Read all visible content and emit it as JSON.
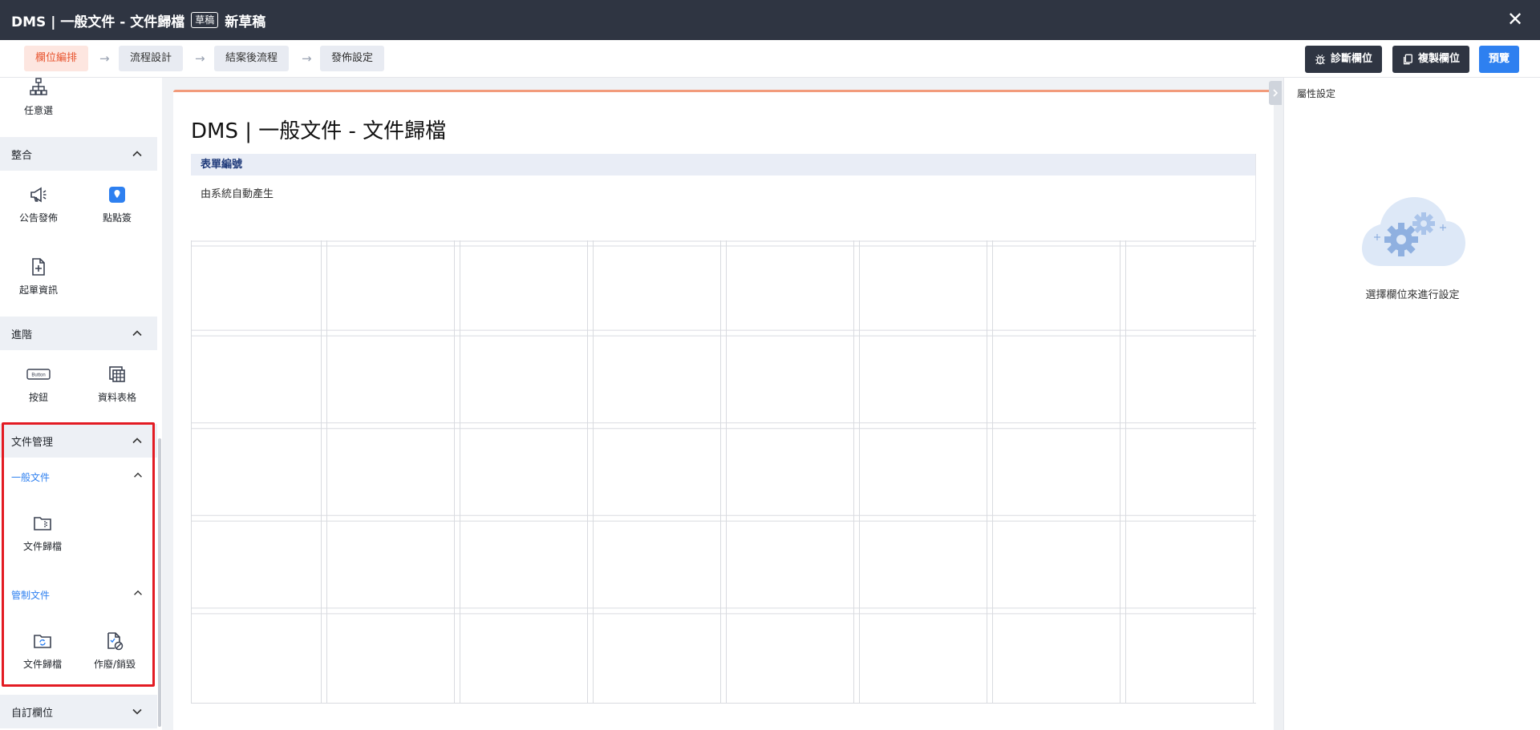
{
  "window": {
    "title": "DMS | 一般文件 - 文件歸檔",
    "badge": "草稿",
    "status": "新草稿",
    "close_glyph": "✕"
  },
  "steps": [
    {
      "label": "欄位編排",
      "active": true
    },
    {
      "label": "流程設計",
      "active": false
    },
    {
      "label": "結案後流程",
      "active": false
    },
    {
      "label": "發佈設定",
      "active": false
    }
  ],
  "step_arrow": "→",
  "toolbar": {
    "diagnose": "診斷欄位",
    "copy": "複製欄位",
    "preview": "預覽"
  },
  "palette": {
    "top_item": {
      "label": "任意選",
      "icon": "org-chart-icon"
    },
    "sections": {
      "integration": {
        "title": "整合",
        "items": [
          {
            "label": "公告發佈",
            "icon": "megaphone-icon"
          },
          {
            "label": "點點簽",
            "icon": "sign-badge-icon"
          },
          {
            "label": "起單資訊",
            "icon": "file-plus-icon"
          }
        ]
      },
      "advanced": {
        "title": "進階",
        "items": [
          {
            "label": "按鈕",
            "icon": "button-icon",
            "icon_text": "Button"
          },
          {
            "label": "資料表格",
            "icon": "table-grid-icon"
          }
        ]
      },
      "docmgmt": {
        "title": "文件管理",
        "general": {
          "title": "一般文件",
          "items": [
            {
              "label": "文件歸檔",
              "icon": "folder-archive-icon"
            }
          ]
        },
        "controlled": {
          "title": "管制文件",
          "items": [
            {
              "label": "文件歸檔",
              "icon": "folder-sync-icon"
            },
            {
              "label": "作廢/銷毀",
              "icon": "file-void-icon"
            }
          ]
        }
      },
      "custom": {
        "title": "自訂欄位"
      }
    }
  },
  "form": {
    "title": "DMS | 一般文件 - 文件歸檔",
    "field_label": "表單編號",
    "field_value": "由系統自動產生",
    "grid_rows": 5,
    "grid_cols": 8
  },
  "properties": {
    "header": "屬性設定",
    "empty_message": "選擇欄位來進行設定",
    "empty_icon": "gear-cloud-icon"
  },
  "colors": {
    "titlebar": "#2f3542",
    "accent": "#e8542e",
    "primary": "#2e80f0",
    "highlight": "#e31b23"
  }
}
